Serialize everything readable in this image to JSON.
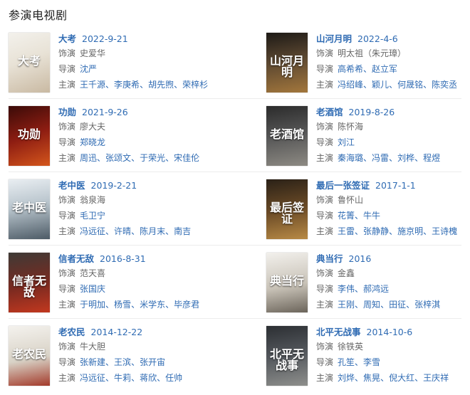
{
  "section": {
    "title": "参演电视剧"
  },
  "labels": {
    "role": "饰演",
    "director": "导演",
    "cast": "主演"
  },
  "colors": {
    "link": "#2f6bb3",
    "text": "#666666"
  },
  "dramas": [
    {
      "title": "大考",
      "date": "2022-9-21",
      "role": "史爱华",
      "directors": [
        "沈严"
      ],
      "cast": [
        "王千源",
        "李庚希",
        "胡先煦",
        "荣梓杉"
      ],
      "poster": {
        "text": "大考",
        "bg": "linear-gradient(160deg,#f3f1ec 0%,#e8e2d6 45%,#c9b9a2 100%)"
      }
    },
    {
      "title": "山河月明",
      "date": "2022-4-6",
      "role": "明太祖（朱元璋）",
      "directors": [
        "高希希",
        "赵立军"
      ],
      "cast": [
        "冯绍峰",
        "颖儿",
        "何晟铭",
        "陈奕丞"
      ],
      "poster": {
        "text": "山河月明",
        "bg": "linear-gradient(170deg,#1d1a16 0%,#5a4630 45%,#a3773c 100%)"
      }
    },
    {
      "title": "功勋",
      "date": "2021-9-26",
      "role": "廖大夫",
      "directors": [
        "郑晓龙"
      ],
      "cast": [
        "周迅",
        "张颂文",
        "于荣光",
        "宋佳伦"
      ],
      "poster": {
        "text": "功勋",
        "bg": "linear-gradient(160deg,#3a0b08 0%,#8e1d12 50%,#d4561c 100%)"
      }
    },
    {
      "title": "老酒馆",
      "date": "2019-8-26",
      "role": "陈怀海",
      "directors": [
        "刘江"
      ],
      "cast": [
        "秦海璐",
        "冯雷",
        "刘桦",
        "程煜"
      ],
      "poster": {
        "text": "老酒馆",
        "bg": "linear-gradient(170deg,#2b2b2b 0%,#585858 50%,#8d8a83 100%)"
      }
    },
    {
      "title": "老中医",
      "date": "2019-2-21",
      "role": "翁泉海",
      "directors": [
        "毛卫宁"
      ],
      "cast": [
        "冯远征",
        "许晴",
        "陈月末",
        "南吉"
      ],
      "poster": {
        "text": "老中医",
        "bg": "linear-gradient(170deg,#e9eef2 0%,#b8c4cc 45%,#4d5b66 100%)"
      }
    },
    {
      "title": "最后一张签证",
      "date": "2017-1-1",
      "role": "鲁怀山",
      "directors": [
        "花箐",
        "牛牛"
      ],
      "cast": [
        "王雷",
        "张静静",
        "施京明",
        "王诗槐"
      ],
      "poster": {
        "text": "最后签证",
        "bg": "linear-gradient(170deg,#2a2117 0%,#6a4a26 50%,#b88a45 100%)"
      }
    },
    {
      "title": "信者无敌",
      "date": "2016-8-31",
      "role": "范天喜",
      "directors": [
        "张国庆"
      ],
      "cast": [
        "于明加",
        "杨雪",
        "米学东",
        "毕彦君"
      ],
      "poster": {
        "text": "信者无敌",
        "bg": "linear-gradient(170deg,#3e3a36 0%,#7a2a20 55%,#c2381f 100%)"
      }
    },
    {
      "title": "典当行",
      "date": "2016",
      "role": "金鑫",
      "directors": [
        "李伟",
        "郝鸿远"
      ],
      "cast": [
        "王刚",
        "周知",
        "田征",
        "张梓淇"
      ],
      "poster": {
        "text": "典当行",
        "bg": "linear-gradient(170deg,#f2f0ec 0%,#c9c3b8 55%,#6b645a 100%)"
      }
    },
    {
      "title": "老农民",
      "date": "2014-12-22",
      "role": "牛大胆",
      "directors": [
        "张新建",
        "王滨",
        "张开宙"
      ],
      "cast": [
        "冯远征",
        "牛莉",
        "蒋欣",
        "任帅"
      ],
      "poster": {
        "text": "老农民",
        "bg": "linear-gradient(170deg,#f4f2ee 0%,#d8d2c6 55%,#a33a2a 100%)"
      }
    },
    {
      "title": "北平无战事",
      "date": "2014-10-6",
      "role": "徐铁英",
      "directors": [
        "孔笙",
        "李雪"
      ],
      "cast": [
        "刘烨",
        "焦晃",
        "倪大红",
        "王庆祥"
      ],
      "poster": {
        "text": "北平无战事",
        "bg": "linear-gradient(170deg,#2c2f33 0%,#55595e 50%,#8e8f8c 100%)"
      }
    }
  ]
}
